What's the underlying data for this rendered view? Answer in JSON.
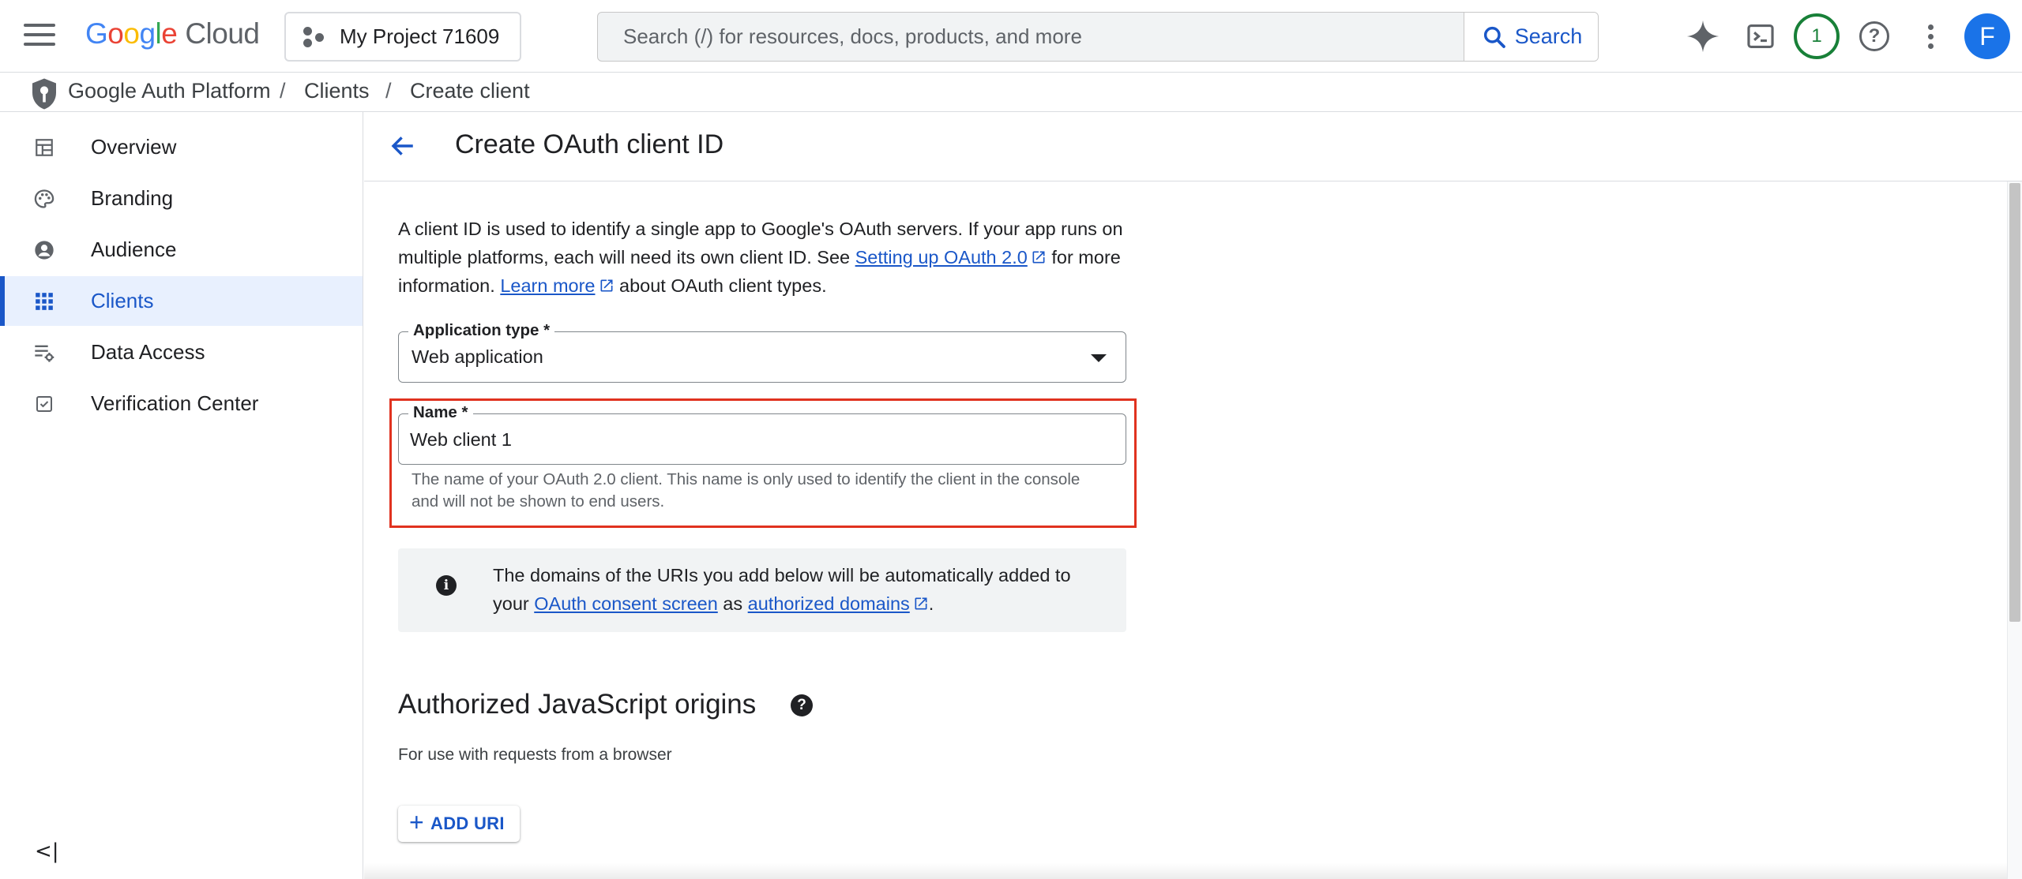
{
  "topbar": {
    "logo_letters": [
      "G",
      "o",
      "o",
      "g",
      "l",
      "e"
    ],
    "logo_suffix": "Cloud",
    "project_name": "My Project 71609",
    "search_placeholder": "Search (/) for resources, docs, products, and more",
    "search_button_label": "Search",
    "notification_count": "1",
    "avatar_initial": "F",
    "icons": [
      "menu-icon",
      "project-icon",
      "search-icon",
      "gemini-sparkle-icon",
      "cloud-shell-icon",
      "help-icon",
      "more-vert-icon"
    ]
  },
  "breadcrumb": {
    "items": [
      "Google Auth Platform",
      "Clients",
      "Create client"
    ],
    "separator": "/"
  },
  "sidebar": {
    "items": [
      {
        "label": "Overview",
        "icon": "dashboard-icon"
      },
      {
        "label": "Branding",
        "icon": "palette-icon"
      },
      {
        "label": "Audience",
        "icon": "account-circle-icon"
      },
      {
        "label": "Clients",
        "icon": "apps-grid-icon",
        "active": true
      },
      {
        "label": "Data Access",
        "icon": "data-settings-icon"
      },
      {
        "label": "Verification Center",
        "icon": "verified-checkbox-icon"
      }
    ],
    "collapse_glyph": "<|"
  },
  "main": {
    "title": "Create OAuth client ID",
    "intro": {
      "part1": "A client ID is used to identify a single app to Google's OAuth servers. If your app runs on multiple platforms, each will need its own client ID. See ",
      "link1": "Setting up OAuth 2.0",
      "part2": " for more information. ",
      "link2": "Learn more",
      "part3": " about OAuth client types."
    },
    "app_type": {
      "label": "Application type *",
      "value": "Web application"
    },
    "name_field": {
      "label": "Name *",
      "value": "Web client 1",
      "hint": "The name of your OAuth 2.0 client. This name is only used to identify the client in the console and will not be shown to end users."
    },
    "info": {
      "icon_glyph": "i",
      "part1": "The domains of the URIs you add below will be automatically added to your ",
      "link1": "OAuth consent screen",
      "part2": " as ",
      "link2": "authorized domains",
      "part3": "."
    },
    "js_origins": {
      "title": "Authorized JavaScript origins",
      "help_glyph": "?",
      "subtitle": "For use with requests from a browser",
      "add_button": "ADD URI",
      "add_glyph": "+"
    }
  },
  "colors": {
    "accent": "#1a57c8",
    "active_nav_bg": "#e8f0fe",
    "highlight_border": "#e0321f",
    "badge_green": "#188038",
    "avatar_bg": "#1a73e8"
  }
}
